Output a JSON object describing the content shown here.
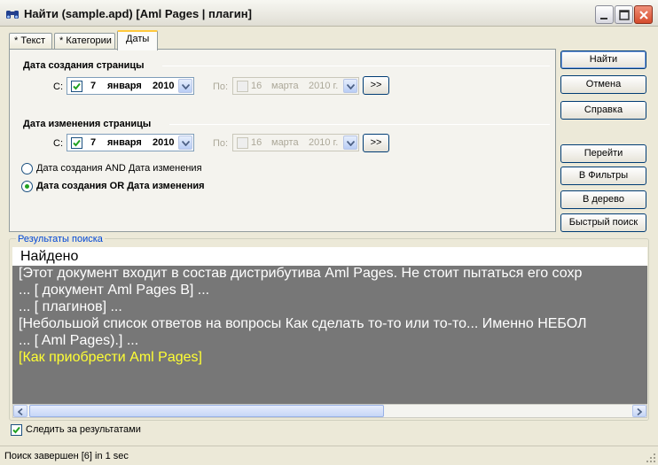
{
  "window": {
    "title": "Найти (sample.apd) [Aml Pages | плагин]"
  },
  "tabs": [
    {
      "label": "Текст",
      "mark": "*"
    },
    {
      "label": "Категории",
      "mark": "*"
    },
    {
      "label": "Даты"
    }
  ],
  "created": {
    "group_title": "Дата создания страницы",
    "from_label": "С:",
    "from": {
      "checked": true,
      "day": "7",
      "month": "января",
      "year": "2010"
    },
    "to_label": "По:",
    "to": {
      "checked": false,
      "day": "16",
      "month": "марта",
      "year": "2010 г."
    },
    "arrow_label": ">>"
  },
  "modified": {
    "group_title": "Дата изменения страницы",
    "from_label": "С:",
    "from": {
      "checked": true,
      "day": "7",
      "month": "января",
      "year": "2010"
    },
    "to_label": "По:",
    "to": {
      "checked": false,
      "day": "16",
      "month": "марта",
      "year": "2010 г."
    },
    "arrow_label": ">>"
  },
  "logic": {
    "options": [
      {
        "label": "Дата создания AND Дата изменения",
        "selected": false
      },
      {
        "label": "Дата создания OR Дата изменения",
        "selected": true
      }
    ]
  },
  "buttons": {
    "find": "Найти",
    "cancel": "Отмена",
    "help": "Справка",
    "goto": "Перейти",
    "to_filters": "В Фильтры",
    "to_tree": "В дерево",
    "quick_search": "Быстрый поиск"
  },
  "results": {
    "legend": "Результаты поиска",
    "header": "Найдено",
    "lines": [
      {
        "text": "[Этот документ входит в состав дистрибутива Aml Pages. Не стоит пытаться его сохр",
        "link": false
      },
      {
        "text": "... [ документ Aml Pages B] ...",
        "link": false
      },
      {
        "text": "... [ плагинов] ...",
        "link": false
      },
      {
        "text": "[Небольшой список ответов на вопросы Как сделать то-то или то-то... Именно НЕБОЛ",
        "link": false
      },
      {
        "text": "... [ Aml Pages).] ...",
        "link": false
      },
      {
        "text": "[Как приобрести Aml Pages]",
        "link": true
      }
    ]
  },
  "follow_results": {
    "label": "Следить за результатами",
    "checked": true
  },
  "status": {
    "text": "Поиск завершен [6] in 1 sec"
  },
  "colors": {
    "results_bg": "#777777",
    "link": "#ffff33",
    "tab_accent": "#ffc83c"
  }
}
